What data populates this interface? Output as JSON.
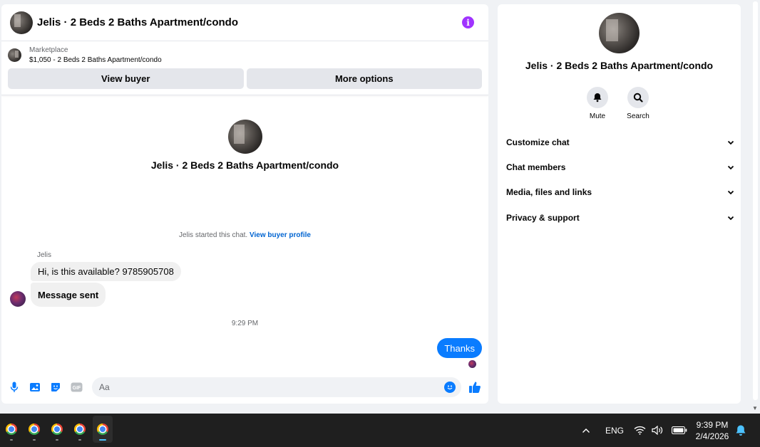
{
  "chat": {
    "title": "Jelis · 2 Beds 2 Baths Apartment/condo",
    "marketplace_label": "Marketplace",
    "listing": "$1,050 - 2 Beds 2 Baths Apartment/condo",
    "view_buyer": "View buyer",
    "more_options": "More options",
    "intro_name": "Jelis · 2 Beds 2 Baths Apartment/condo",
    "started_text": "Jelis started this chat.",
    "view_buyer_profile": "View buyer profile",
    "sender_name": "Jelis",
    "messages": [
      {
        "text": "Hi, is this available? 9785905708"
      },
      {
        "text": "Message sent"
      }
    ],
    "timestamp": "9:29 PM",
    "outgoing": "Thanks",
    "composer_placeholder": "Aa"
  },
  "info": {
    "name": "Jelis · 2 Beds 2 Baths Apartment/condo",
    "mute_label": "Mute",
    "search_label": "Search",
    "sections": [
      "Customize chat",
      "Chat members",
      "Media, files and links",
      "Privacy & support"
    ]
  },
  "taskbar": {
    "apps": [
      "chrome-icon",
      "chrome-icon",
      "chrome-icon",
      "chrome-icon",
      "chrome-icon"
    ],
    "language": "ENG",
    "time": "9:39 PM",
    "date": "2/4/2026"
  },
  "colors": {
    "accent": "#0a7cff",
    "info": "#a033ff",
    "link": "#0064d1"
  }
}
